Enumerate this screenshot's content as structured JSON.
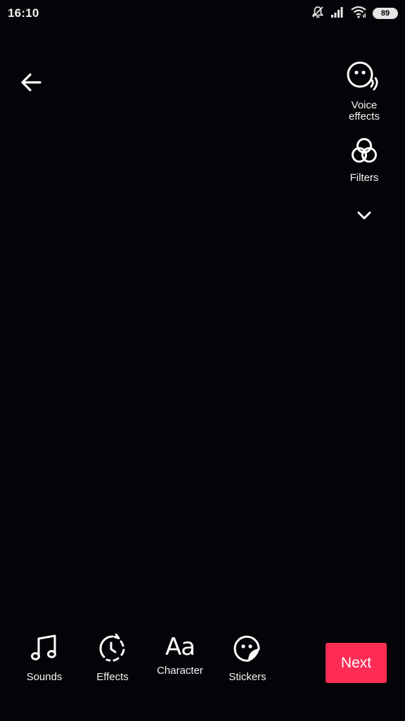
{
  "status_bar": {
    "time": "16:10",
    "icons": [
      "notifications-muted-icon",
      "signal-icon",
      "wifi-icon"
    ],
    "battery_level": "89"
  },
  "top": {
    "back_icon": "arrow-left-icon"
  },
  "side_tools": [
    {
      "label": "Voice\neffects",
      "icon": "voice-effects-icon"
    },
    {
      "label": "Filters",
      "icon": "filters-icon"
    }
  ],
  "more_icon": "chevron-down-icon",
  "bottom_tools": [
    {
      "label": "Sounds",
      "icon": "music-note-icon"
    },
    {
      "label": "Effects",
      "icon": "effects-timer-icon"
    },
    {
      "label": "Character",
      "icon": "text-aa-icon",
      "glyph": "Aa"
    },
    {
      "label": "Stickers",
      "icon": "sticker-icon"
    }
  ],
  "next_button": {
    "label": "Next",
    "color": "#fe2c55"
  }
}
